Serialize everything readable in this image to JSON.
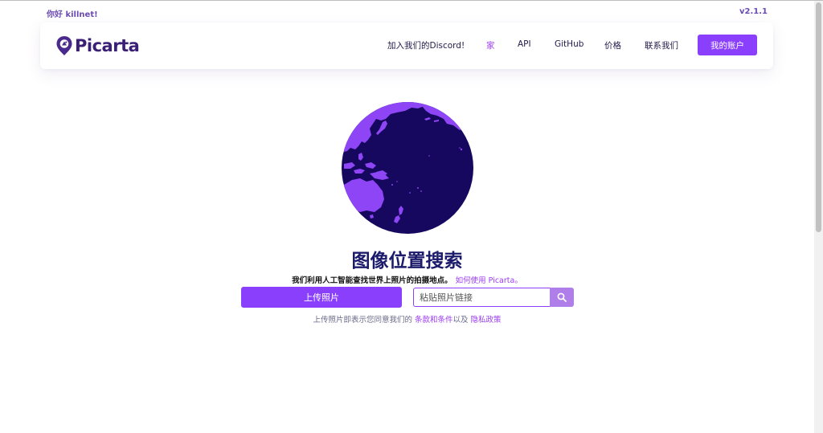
{
  "topbar": {
    "greeting": "你好 killnet!",
    "version": "v2.1.1"
  },
  "navbar": {
    "logo_text": "Picarta",
    "links": [
      {
        "label": "加入我们的Discord!"
      },
      {
        "label": "家"
      },
      {
        "label": "API"
      },
      {
        "label": "GitHub"
      },
      {
        "label": "价格"
      },
      {
        "label": "联系我们"
      }
    ],
    "account_button": "我的账户"
  },
  "hero": {
    "title": "图像位置搜索",
    "subtitle": "我们利用人工智能查找世界上照片的拍摄地点。",
    "how_to_link": "如何使用 Picarta。",
    "upload_button": "上传照片",
    "url_placeholder": "粘贴照片链接",
    "search_icon": "search-icon"
  },
  "terms": {
    "prefix": "上传照片即表示您同意我们的",
    "terms_link": "条款和条件",
    "joiner": "以及",
    "privacy_link": "隐私政策"
  },
  "colors": {
    "accent": "#8a3ffc",
    "globe_ocean": "#16085e",
    "globe_land": "#8e45f5",
    "title": "#1b1a6b"
  }
}
